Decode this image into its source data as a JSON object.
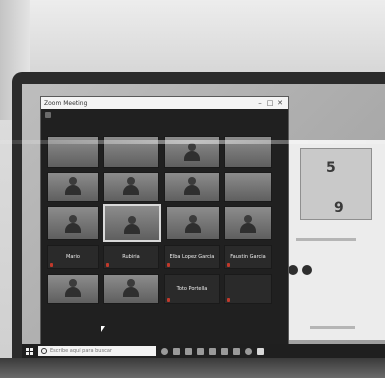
{
  "window": {
    "title": "Zoom Meeting"
  },
  "tiles": [
    {
      "name": ""
    },
    {
      "name": ""
    },
    {
      "name": ""
    },
    {
      "name": ""
    },
    {
      "name": ""
    },
    {
      "name": ""
    },
    {
      "name": ""
    },
    {
      "name": ""
    },
    {
      "name": ""
    },
    {
      "name": ""
    },
    {
      "name": ""
    },
    {
      "name": ""
    },
    {
      "name": "Mario"
    },
    {
      "name": "Rubiria"
    },
    {
      "name": "Elba Lopez Garcia"
    },
    {
      "name": "Faustin Garcia"
    },
    {
      "name": ""
    },
    {
      "name": ""
    },
    {
      "name": "Toto Portella"
    },
    {
      "name": ""
    }
  ],
  "taskbar": {
    "search_placeholder": "Escribe aquí para buscar"
  },
  "background_app": {
    "digits": [
      "5",
      "9"
    ]
  },
  "colors": {
    "zoom_bg": "#202020",
    "taskbar_bg": "#1f1f1f",
    "active_border": "#d9d9d9"
  }
}
